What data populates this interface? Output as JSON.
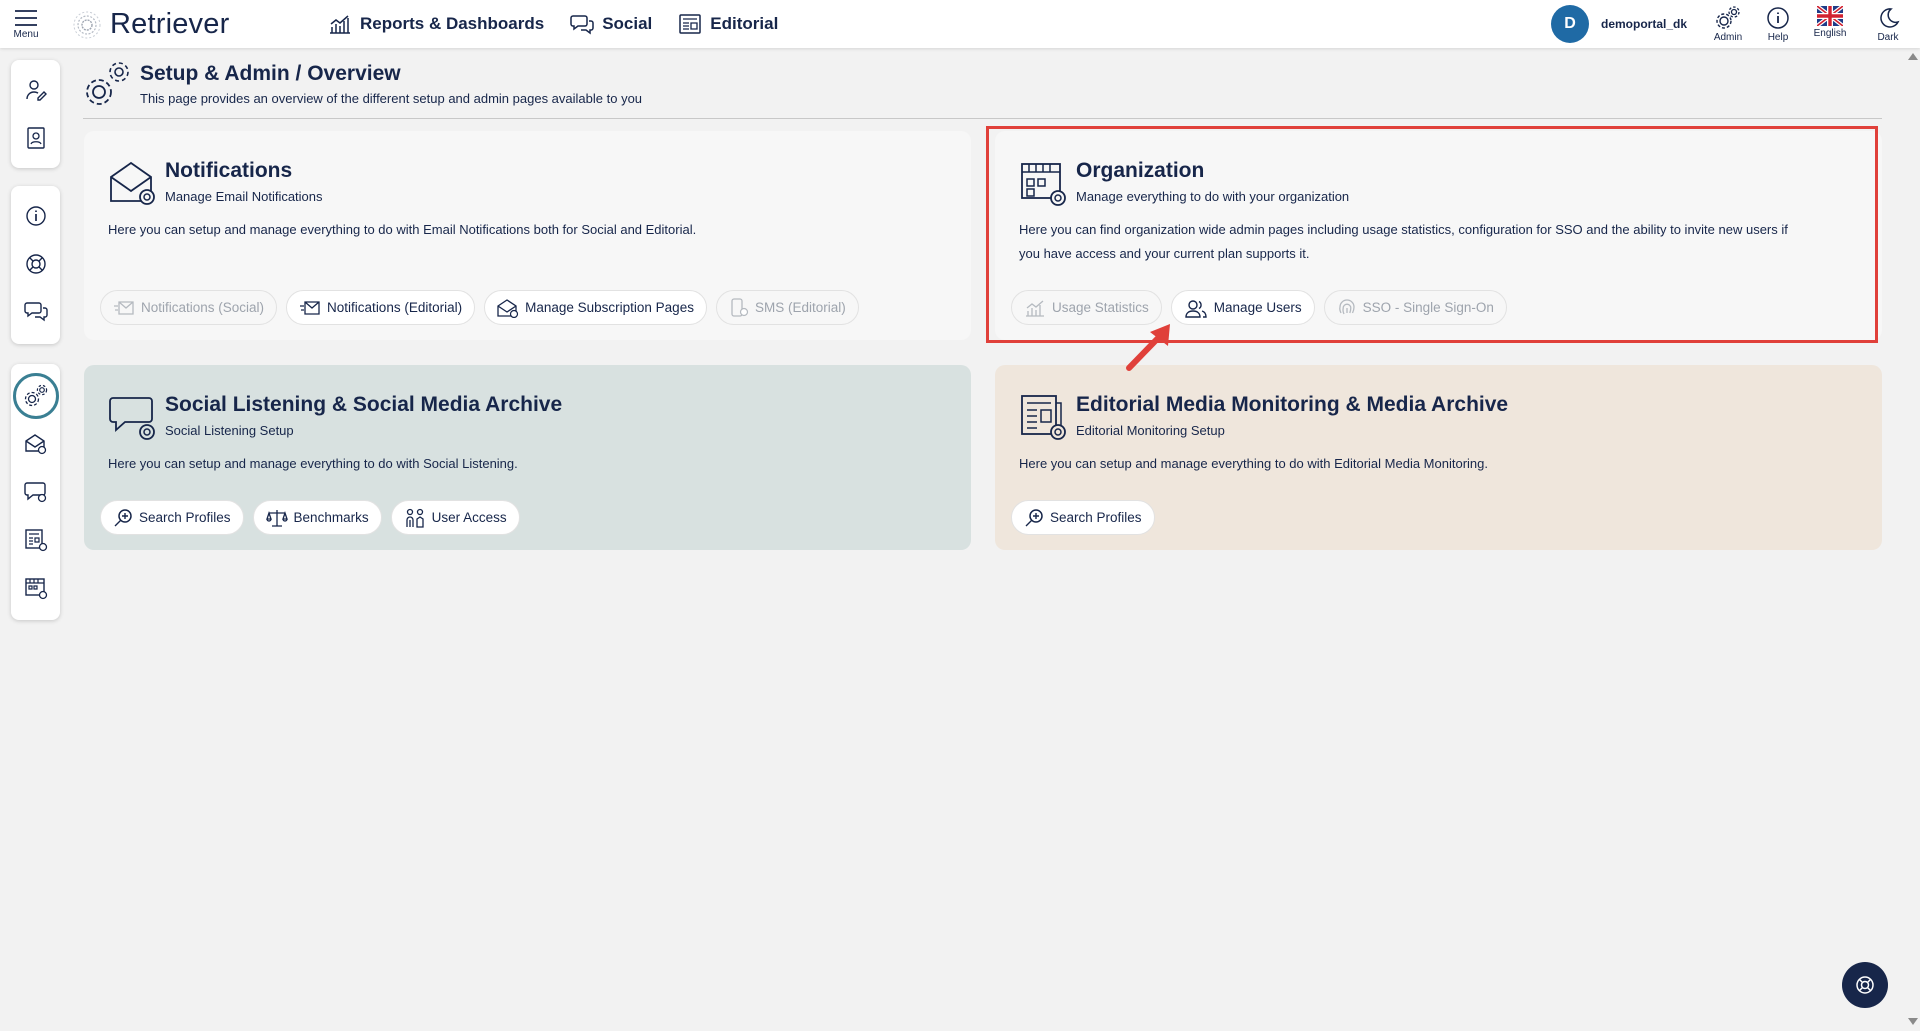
{
  "topbar": {
    "menu_label": "Menu",
    "logo_text": "Retriever",
    "nav": [
      {
        "label": "Reports & Dashboards",
        "icon": "chart-icon"
      },
      {
        "label": "Social",
        "icon": "chat-icon"
      },
      {
        "label": "Editorial",
        "icon": "newspaper-icon"
      }
    ],
    "user": {
      "initial": "D",
      "name": "demoportal_dk"
    },
    "buttons": [
      {
        "label": "Admin",
        "icon": "gear-icon"
      },
      {
        "label": "Help",
        "icon": "info-icon"
      },
      {
        "label": "English",
        "icon": "uk-flag-icon"
      },
      {
        "label": "Dark",
        "icon": "moon-icon"
      }
    ]
  },
  "header": {
    "title": "Setup & Admin / Overview",
    "subtitle": "This page provides an overview of the different setup and admin pages available to you"
  },
  "cards": {
    "notifications": {
      "title": "Notifications",
      "subtitle": "Manage Email Notifications",
      "description": "Here you can setup and manage everything to do with Email Notifications both for Social and Editorial.",
      "links": [
        {
          "label": "Notifications (Social)",
          "enabled": false
        },
        {
          "label": "Notifications (Editorial)",
          "enabled": true
        },
        {
          "label": "Manage Subscription Pages",
          "enabled": true
        },
        {
          "label": "SMS (Editorial)",
          "enabled": false
        }
      ],
      "background": "#f7f7f7"
    },
    "organization": {
      "title": "Organization",
      "subtitle": "Manage everything to do with your organization",
      "description_line1": "Here you can find organization wide admin pages including usage statistics, configuration for SSO and the ability to invite new users if",
      "description_line2": "you have access and your current plan supports it.",
      "links": [
        {
          "label": "Usage Statistics",
          "enabled": false
        },
        {
          "label": "Manage Users",
          "enabled": true
        },
        {
          "label": "SSO - Single Sign-On",
          "enabled": false
        }
      ],
      "background": "#f7f7f7"
    },
    "social": {
      "title": "Social Listening & Social Media Archive",
      "subtitle": "Social Listening Setup",
      "description": "Here you can setup and manage everything to do with Social Listening.",
      "links": [
        {
          "label": "Search Profiles",
          "enabled": true
        },
        {
          "label": "Benchmarks",
          "enabled": true
        },
        {
          "label": "User Access",
          "enabled": true
        }
      ],
      "background": "#d8e1e0"
    },
    "editorial": {
      "title": "Editorial Media Monitoring & Media Archive",
      "subtitle": "Editorial Monitoring Setup",
      "description": "Here you can setup and manage everything to do with Editorial Media Monitoring.",
      "links": [
        {
          "label": "Search Profiles",
          "enabled": true
        }
      ],
      "background": "#efe6dc"
    }
  },
  "colors": {
    "primary": "#17264a",
    "avatar": "#1f6aa5",
    "highlight": "#e0403a",
    "active_ring": "#3a7f93"
  }
}
